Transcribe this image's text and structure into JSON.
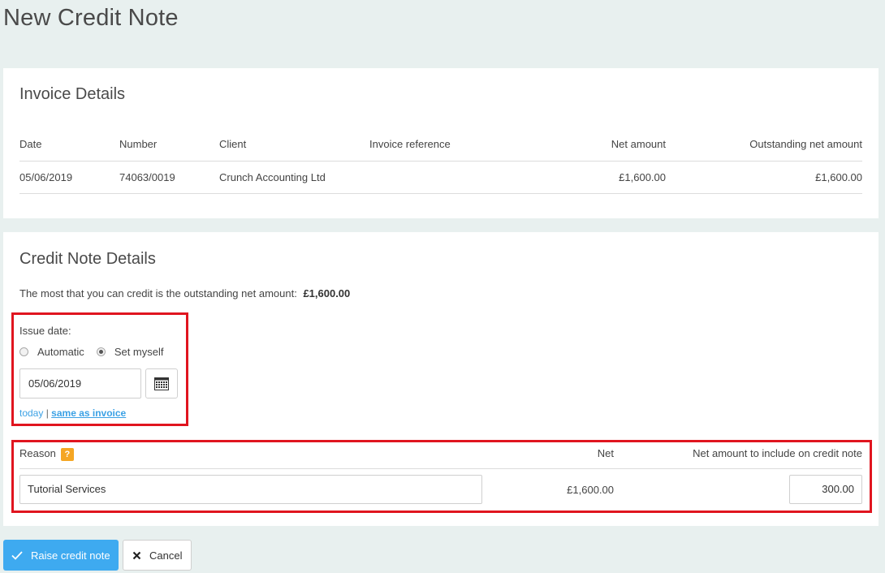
{
  "page": {
    "title": "New Credit Note"
  },
  "invoice": {
    "heading": "Invoice Details",
    "columns": [
      "Date",
      "Number",
      "Client",
      "Invoice reference",
      "Net amount",
      "Outstanding net amount"
    ],
    "row": {
      "date": "05/06/2019",
      "number": "74063/0019",
      "client": "Crunch Accounting Ltd",
      "reference": "",
      "net_amount": "£1,600.00",
      "outstanding": "£1,600.00"
    }
  },
  "credit": {
    "heading": "Credit Note Details",
    "info_text": "The most that you can credit is the outstanding net amount:",
    "info_amount": "£1,600.00",
    "issue_date_label": "Issue date:",
    "radio_automatic": "Automatic",
    "radio_set_myself": "Set myself",
    "selected_radio": "Set myself",
    "date_value": "05/06/2019",
    "link_today": "today",
    "link_separator": "|",
    "link_same": "same as invoice",
    "reason_label": "Reason",
    "help_badge": "?",
    "net_label": "Net",
    "amount_label": "Net amount to include on credit note",
    "reason_value": "Tutorial Services",
    "net_value": "£1,600.00",
    "amount_value": "300.00"
  },
  "actions": {
    "raise_label": "Raise credit note",
    "cancel_label": "Cancel"
  },
  "colors": {
    "accent": "#3eaaf0",
    "highlight": "#e0151f",
    "help_badge": "#f5a623"
  }
}
